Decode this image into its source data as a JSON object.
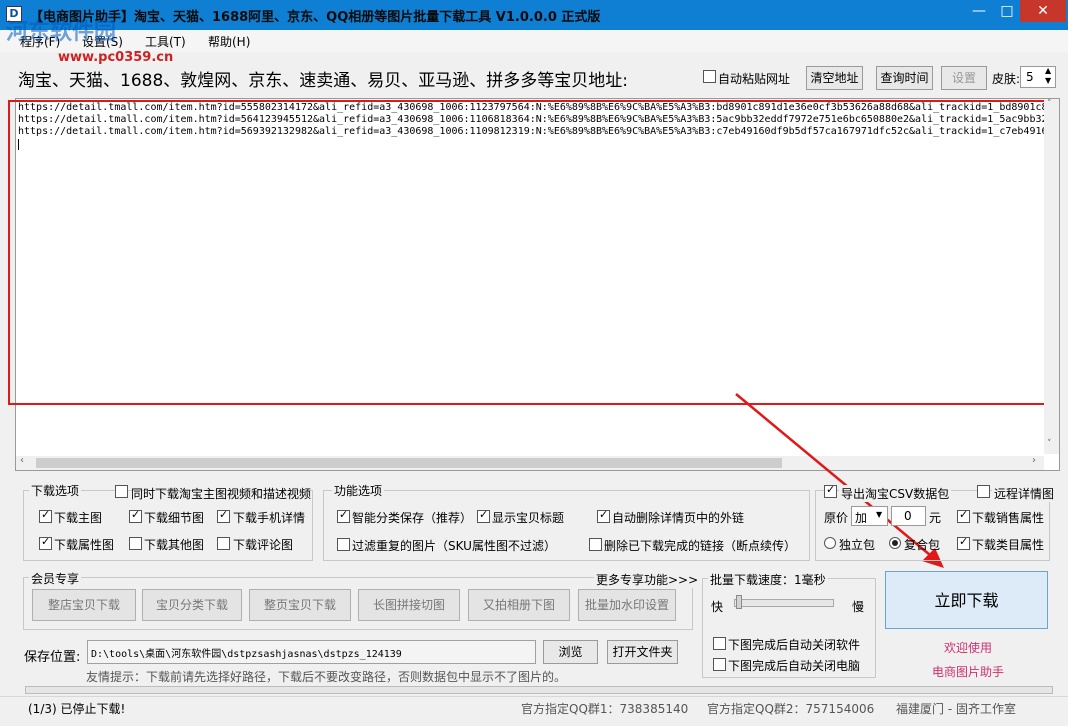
{
  "title": "【电商图片助手】淘宝、天猫、1688阿里、京东、QQ相册等图片批量下载工具 V1.0.0.0 正式版",
  "watermark": {
    "site": "河东软件园",
    "url": "www.pc0359.cn"
  },
  "window_controls": {
    "minimize": "—",
    "maximize": "□",
    "close": "✕"
  },
  "menu": [
    "程序(F)",
    "设置(S)",
    "工具(T)",
    "帮助(H)"
  ],
  "address": {
    "label": "淘宝、天猫、1688、敦煌网、京东、速卖通、易贝、亚马逊、拼多多等宝贝地址:",
    "auto_paste_label": "自动粘贴网址",
    "clear_button": "清空地址",
    "time_button": "查询时间",
    "settings_button": "设置",
    "skin_label": "皮肤:",
    "skin_value": "5"
  },
  "urls": [
    "https://detail.tmall.com/item.htm?id=555802314172&ali_refid=a3_430698_1006:1123797564:N:%E6%89%8B%E6%9C%BA%E5%A3%B3:bd8901c891d1e36e0cf3b53626a88d68&ali_trackid=1_bd8901c8",
    "https://detail.tmall.com/item.htm?id=564123945512&ali_refid=a3_430698_1006:1106818364:N:%E6%89%8B%E6%9C%BA%E5%A3%B3:5ac9bb32eddf7972e751e6bc650880e2&ali_trackid=1_5ac9bb32",
    "https://detail.tmall.com/item.htm?id=569392132982&ali_refid=a3_430698_1006:1109812319:N:%E6%89%8B%E6%9C%BA%E5%A3%B3:c7eb49160df9b5df57ca167971dfc52c&ali_trackid=1_c7eb4916"
  ],
  "download_options": {
    "title": "下载选项",
    "video_label": "同时下载淘宝主图视频和描述视频",
    "main_image": "下载主图",
    "detail_image": "下载细节图",
    "mobile_detail": "下载手机详情",
    "attr_image": "下载属性图",
    "other_image": "下载其他图",
    "review_image": "下载评论图"
  },
  "function_options": {
    "title": "功能选项",
    "smart_save": "智能分类保存（推荐）",
    "show_title": "显示宝贝标题",
    "auto_delete": "自动删除详情页中的外链",
    "filter_dup": "过滤重复的图片（SKU属性图不过滤）",
    "delete_done": "删除已下载完成的链接（断点续传）"
  },
  "export_options": {
    "csv_label": "导出淘宝CSV数据包",
    "remote_detail": "远程详情图",
    "price_label": "原价",
    "price_op": "加",
    "price_value": "0",
    "price_unit": "元",
    "sales_attr": "下载销售属性",
    "standalone": "独立包",
    "combined": "复合包",
    "category_attr": "下载类目属性"
  },
  "member": {
    "title": "会员专享",
    "more": "更多专享功能>>>",
    "buttons": [
      "整店宝贝下载",
      "宝贝分类下载",
      "整页宝贝下载",
      "长图拼接切图",
      "又拍相册下图",
      "批量加水印设置"
    ]
  },
  "speed": {
    "title": "批量下载速度：1毫秒",
    "fast": "快",
    "slow": "慢",
    "level": 0.0,
    "close_app": "下图完成后自动关闭软件",
    "close_pc": "下图完成后自动关闭电脑"
  },
  "download_button": "立即下载",
  "welcome": [
    "欢迎使用",
    "电商图片助手"
  ],
  "save": {
    "label": "保存位置:",
    "path": "D:\\tools\\桌面\\河东软件园\\dstpzsashjasnas\\dstpzs_124139",
    "browse": "浏览",
    "open_folder": "打开文件夹",
    "tip": "友情提示：下载前请先选择好路径，下载后不要改变路径，否则数据包中显示不了图片的。"
  },
  "status": {
    "left": "(1/3) 已停止下载!",
    "qq1": "官方指定QQ群1：738385140",
    "qq2": "官方指定QQ群2：757154006",
    "studio": "福建厦门 - 固齐工作室"
  },
  "colors": {
    "titlebar": "#0f7fd3",
    "highlight": "#e01818",
    "accent_text": "#d0306f"
  }
}
